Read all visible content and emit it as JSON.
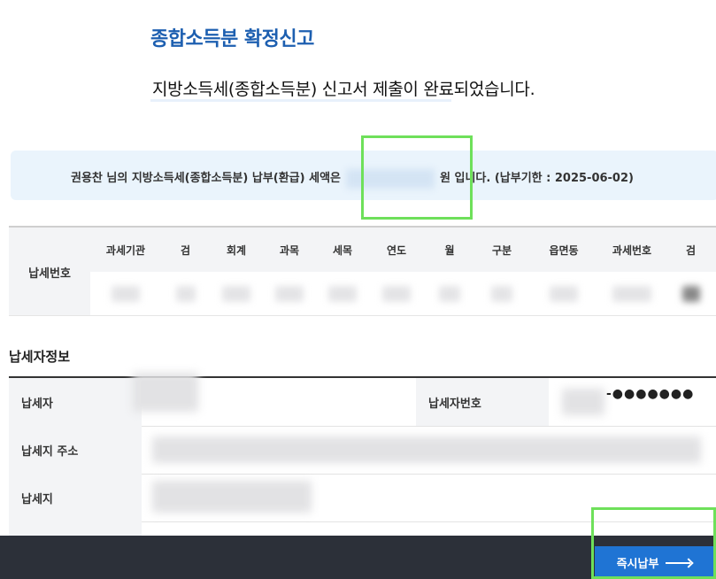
{
  "header": {
    "title": "종합소득분 확정신고",
    "message": "지방소득세(종합소득분) 신고서 제출이 완료되었습니다."
  },
  "notice": {
    "prefix": "권용찬 님의 지방소득세(종합소득분) 납부(환급) 세액은",
    "suffix": "원 입니다. (납부기한 : 2025-06-02)"
  },
  "tax_number": {
    "row_label": "납세번호",
    "columns": [
      "과세기관",
      "검",
      "회계",
      "과목",
      "세목",
      "연도",
      "월",
      "구분",
      "읍면동",
      "과세번호",
      "검"
    ]
  },
  "taxpayer_info": {
    "section_title": "납세자정보",
    "rows": [
      {
        "label": "납세자",
        "label2": "납세자번호",
        "value2": "-●●●●●●●"
      },
      {
        "label": "납세지 주소"
      },
      {
        "label": "납세지"
      }
    ]
  },
  "footer": {
    "pay_button": "즉시납부"
  },
  "colors": {
    "title_blue": "#1d5fb0",
    "notice_bg": "#eaf4fc",
    "button_blue": "#1f74d4",
    "bottom_bar": "#2c3039",
    "highlight_green": "#6ee05a"
  }
}
